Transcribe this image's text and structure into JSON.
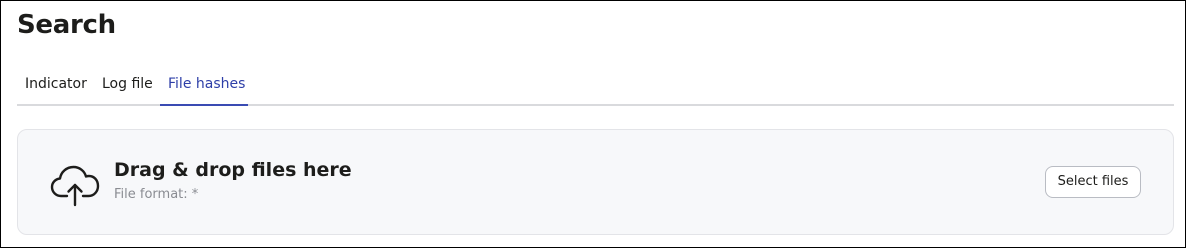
{
  "page": {
    "title": "Search"
  },
  "tabs": [
    {
      "label": "Indicator",
      "active": false
    },
    {
      "label": "Log file",
      "active": false
    },
    {
      "label": "File hashes",
      "active": true
    }
  ],
  "dropzone": {
    "icon": "cloud-upload-icon",
    "title": "Drag & drop files here",
    "subtitle": "File format: *",
    "button_label": "Select files"
  },
  "colors": {
    "active_tab": "#2e3fa8",
    "dropzone_bg": "#f7f8fa",
    "text": "#1d1d1b",
    "muted_text": "#8a8c92"
  }
}
